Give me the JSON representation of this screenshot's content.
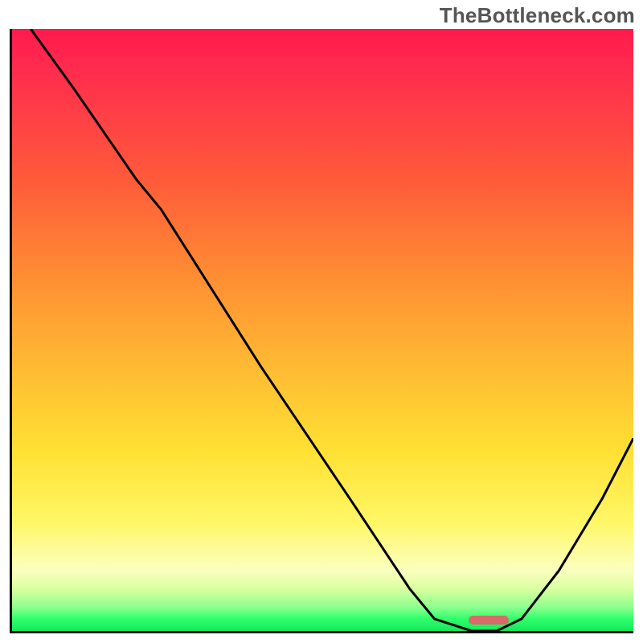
{
  "watermark": "TheBottleneck.com",
  "chart_data": {
    "type": "line",
    "title": "",
    "xlabel": "",
    "ylabel": "",
    "xlim": [
      0,
      100
    ],
    "ylim": [
      0,
      100
    ],
    "grid": false,
    "legend": false,
    "series": [
      {
        "name": "curve",
        "x": [
          3,
          10,
          20,
          24,
          40,
          55,
          64,
          68,
          74,
          78,
          82,
          88,
          95,
          100
        ],
        "y": [
          100,
          90,
          75,
          70,
          44,
          21,
          7,
          2,
          0,
          0,
          2,
          10,
          22,
          32
        ],
        "stroke": "#000000",
        "stroke_width": 3
      }
    ],
    "marker": {
      "x": 73.5,
      "y": 1.0,
      "width": 6.5,
      "height": 1.6,
      "color": "#d86a6a"
    },
    "background_gradient": {
      "type": "vertical",
      "stops": [
        {
          "pos": 0.0,
          "color": "#ff1a4d"
        },
        {
          "pos": 0.25,
          "color": "#ff5a3a"
        },
        {
          "pos": 0.55,
          "color": "#ffb733"
        },
        {
          "pos": 0.82,
          "color": "#fff766"
        },
        {
          "pos": 0.93,
          "color": "#d9ff9f"
        },
        {
          "pos": 1.0,
          "color": "#14e85c"
        }
      ]
    }
  }
}
